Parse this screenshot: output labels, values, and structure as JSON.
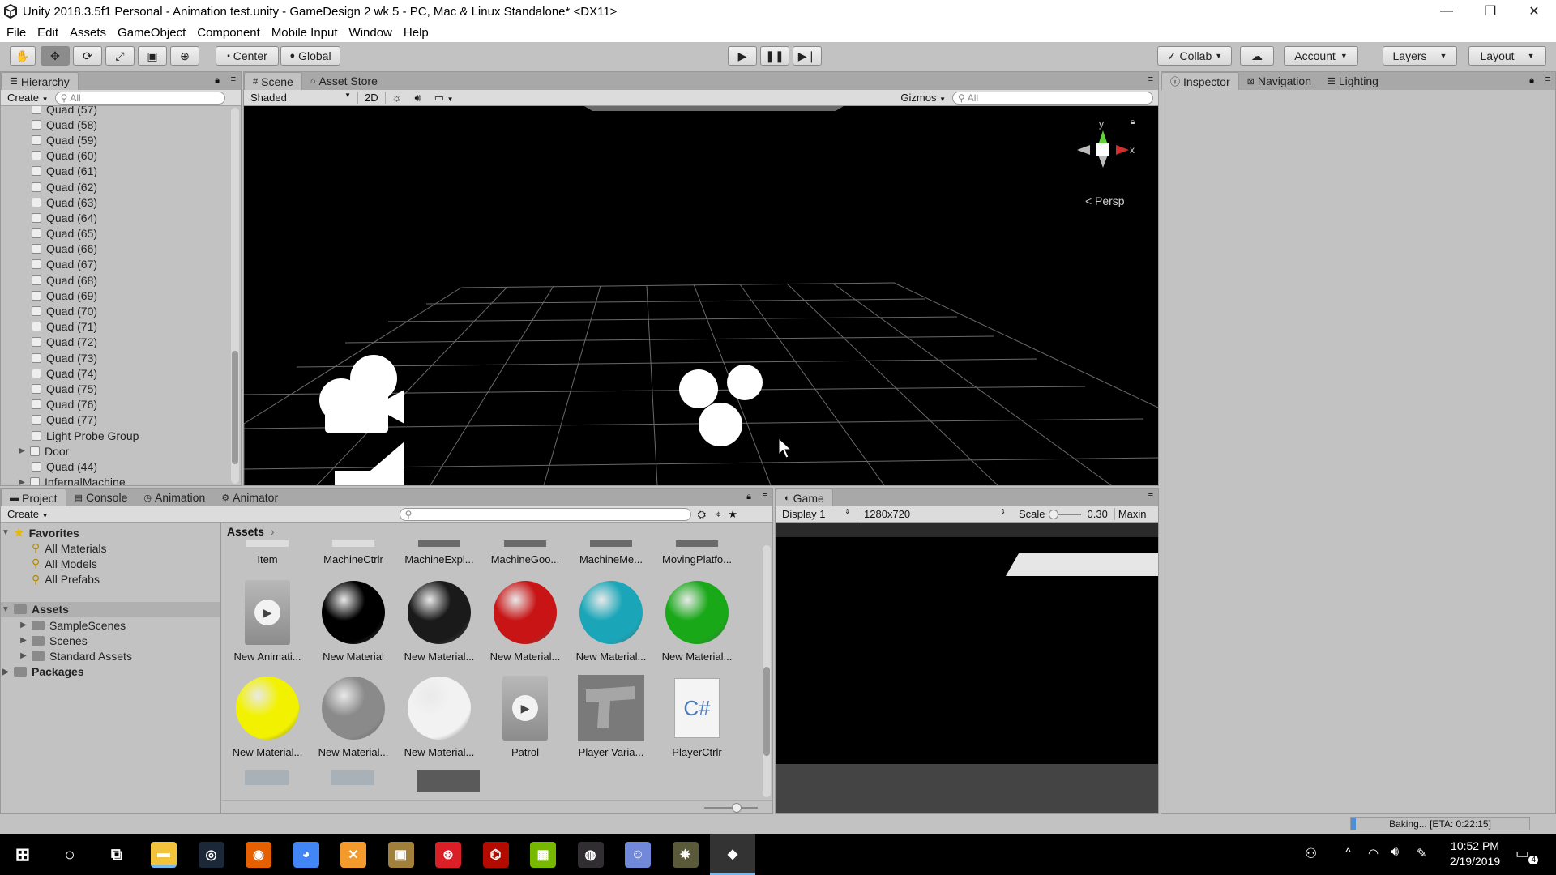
{
  "window": {
    "title": "Unity 2018.3.5f1 Personal - Animation test.unity - GameDesign 2 wk 5 - PC, Mac & Linux Standalone* <DX11>",
    "minimize_glyph": "—",
    "maximize_glyph": "❐",
    "close_glyph": "✕"
  },
  "menu": [
    "File",
    "Edit",
    "Assets",
    "GameObject",
    "Component",
    "Mobile Input",
    "Window",
    "Help"
  ],
  "toolbar": {
    "pivot": "Center",
    "space": "Global",
    "collab": "Collab",
    "account": "Account",
    "layers": "Layers",
    "layout": "Layout"
  },
  "hierarchy": {
    "tab": "Hierarchy",
    "create": "Create",
    "search_placeholder": "All",
    "items": [
      {
        "label": "Quad (57)",
        "arrow": ""
      },
      {
        "label": "Quad (58)",
        "arrow": ""
      },
      {
        "label": "Quad (59)",
        "arrow": ""
      },
      {
        "label": "Quad (60)",
        "arrow": ""
      },
      {
        "label": "Quad (61)",
        "arrow": ""
      },
      {
        "label": "Quad (62)",
        "arrow": ""
      },
      {
        "label": "Quad (63)",
        "arrow": ""
      },
      {
        "label": "Quad (64)",
        "arrow": ""
      },
      {
        "label": "Quad (65)",
        "arrow": ""
      },
      {
        "label": "Quad (66)",
        "arrow": ""
      },
      {
        "label": "Quad (67)",
        "arrow": ""
      },
      {
        "label": "Quad (68)",
        "arrow": ""
      },
      {
        "label": "Quad (69)",
        "arrow": ""
      },
      {
        "label": "Quad (70)",
        "arrow": ""
      },
      {
        "label": "Quad (71)",
        "arrow": ""
      },
      {
        "label": "Quad (72)",
        "arrow": ""
      },
      {
        "label": "Quad (73)",
        "arrow": ""
      },
      {
        "label": "Quad (74)",
        "arrow": ""
      },
      {
        "label": "Quad (75)",
        "arrow": ""
      },
      {
        "label": "Quad (76)",
        "arrow": ""
      },
      {
        "label": "Quad (77)",
        "arrow": ""
      },
      {
        "label": "Light Probe Group",
        "arrow": ""
      },
      {
        "label": "Door",
        "arrow": "▶"
      },
      {
        "label": "Quad (44)",
        "arrow": ""
      },
      {
        "label": "InfernalMachine",
        "arrow": "▶"
      }
    ]
  },
  "scene": {
    "tabs": [
      "Scene",
      "Asset Store"
    ],
    "shading": "Shaded",
    "mode_2d": "2D",
    "gizmos": "Gizmos",
    "search_placeholder": "All",
    "gizmo_y": "y",
    "gizmo_x": "x",
    "persp": "Persp"
  },
  "inspector": {
    "tabs": [
      "Inspector",
      "Navigation",
      "Lighting"
    ]
  },
  "project": {
    "tabs": [
      "Project",
      "Console",
      "Animation",
      "Animator"
    ],
    "create": "Create",
    "favorites_label": "Favorites",
    "favorites": [
      "All Materials",
      "All Models",
      "All Prefabs"
    ],
    "assets_label": "Assets",
    "asset_folders": [
      "SampleScenes",
      "Scenes",
      "Standard Assets"
    ],
    "packages_label": "Packages",
    "breadcrumb": "Assets",
    "top_row": [
      "Item",
      "MachineCtrlr",
      "MachineExpl...",
      "MachineGoo...",
      "MachineMe...",
      "MovingPlatfo..."
    ],
    "row2": [
      {
        "label": "New Animati...",
        "kind": "anim"
      },
      {
        "label": "New Material",
        "kind": "sphere",
        "color": "#000000"
      },
      {
        "label": "New Material...",
        "kind": "sphere",
        "color": "#1a1a1a"
      },
      {
        "label": "New Material...",
        "kind": "sphere",
        "color": "#c81414"
      },
      {
        "label": "New Material...",
        "kind": "sphere",
        "color": "#1aa6b8"
      },
      {
        "label": "New Material...",
        "kind": "sphere",
        "color": "#18a818"
      }
    ],
    "row3": [
      {
        "label": "New Material...",
        "kind": "sphere",
        "color": "#f2f200"
      },
      {
        "label": "New Material...",
        "kind": "sphere",
        "color": "#8a8a8a"
      },
      {
        "label": "New Material...",
        "kind": "sphere",
        "color": "#f2f2f2"
      },
      {
        "label": "Patrol",
        "kind": "anim"
      },
      {
        "label": "Player Varia...",
        "kind": "model"
      },
      {
        "label": "PlayerCtrlr",
        "kind": "script",
        "glyph": "C#"
      }
    ]
  },
  "game": {
    "tab": "Game",
    "display": "Display 1",
    "resolution": "1280x720",
    "scale_label": "Scale",
    "scale_value": "0.30",
    "maximize": "Maxin"
  },
  "status": {
    "baking": "Baking... [ETA: 0:22:15]"
  },
  "taskbar": {
    "time": "10:52 PM",
    "date": "2/19/2019",
    "notifications": "4",
    "apps": [
      {
        "name": "file-explorer",
        "color": "#f3c23c"
      },
      {
        "name": "steam",
        "color": "#1b2838"
      },
      {
        "name": "firefox",
        "color": "#e66000"
      },
      {
        "name": "chrome",
        "color": "#4285f4"
      },
      {
        "name": "app-x",
        "color": "#f49a2c"
      },
      {
        "name": "app-box",
        "color": "#a0803a"
      },
      {
        "name": "creative-cloud",
        "color": "#da1f26"
      },
      {
        "name": "acrobat",
        "color": "#b30b00"
      },
      {
        "name": "nvidia",
        "color": "#76b900"
      },
      {
        "name": "obs",
        "color": "#302e31"
      },
      {
        "name": "discord",
        "color": "#7289da"
      },
      {
        "name": "app-star",
        "color": "#5a5a3a"
      },
      {
        "name": "unity",
        "color": "#222222"
      }
    ]
  }
}
